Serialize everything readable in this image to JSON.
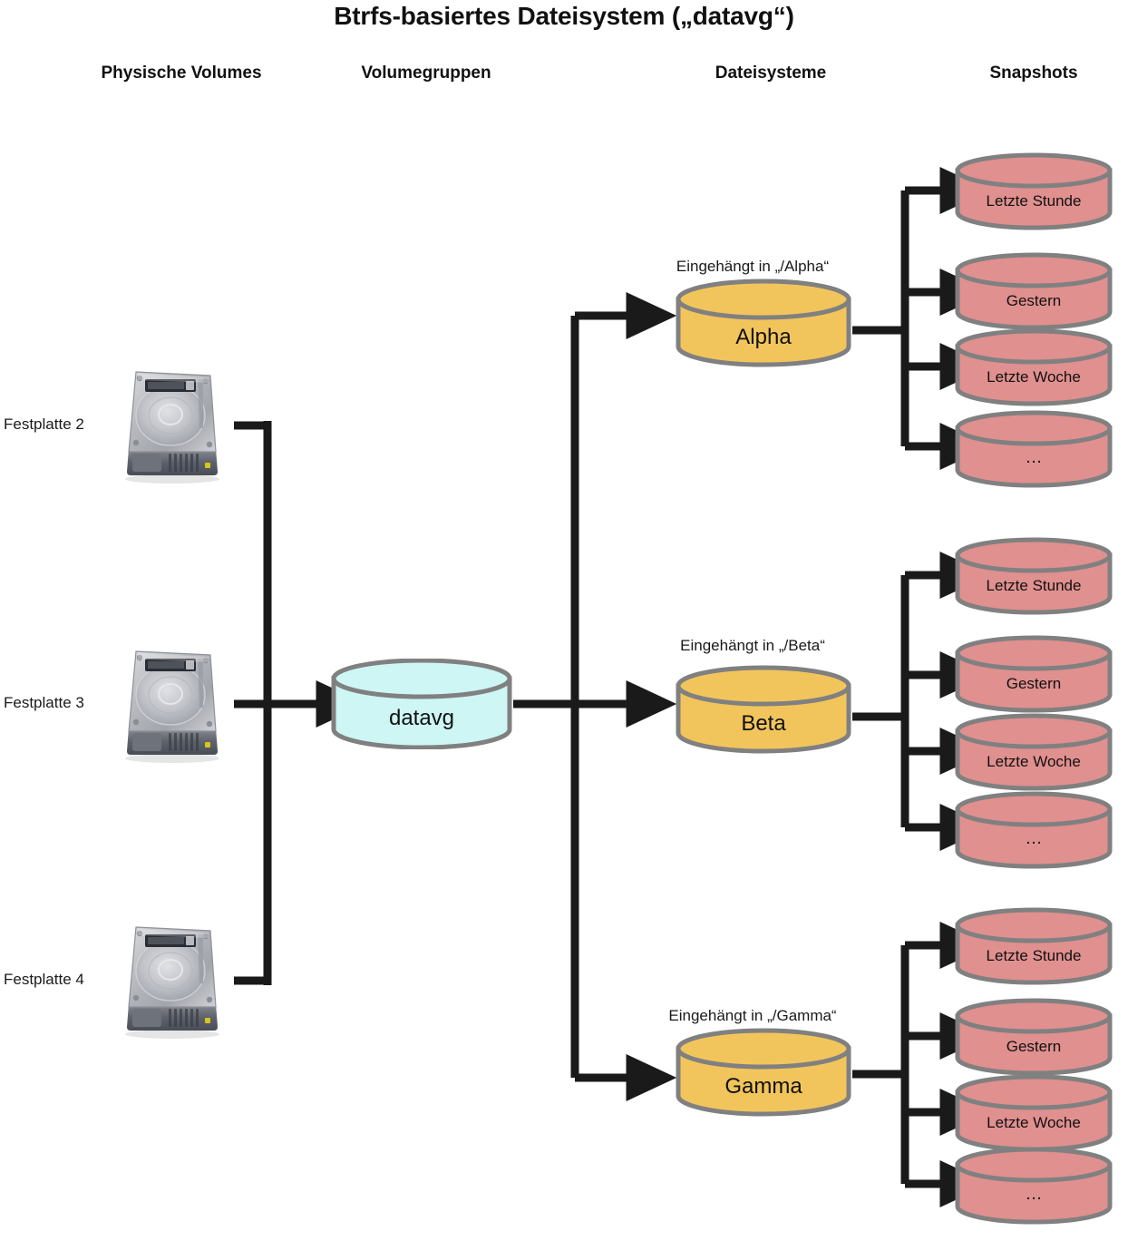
{
  "diagram": {
    "title": "Btrfs-basiertes Dateisystem („datavg“)",
    "columns": [
      {
        "id": "physical-volumes",
        "label": "Physische Volumes"
      },
      {
        "id": "volume-groups",
        "label": "Volumegruppen"
      },
      {
        "id": "filesystems",
        "label": "Dateisysteme"
      },
      {
        "id": "snapshots",
        "label": "Snapshots"
      }
    ],
    "colors": {
      "volume_group_fill": "#cdf6f5",
      "filesystem_fill": "#f2c55c",
      "snapshot_fill": "#e0908f",
      "cylinder_stroke": "#808080",
      "connector": "#1a1a1a",
      "background": "#ffffff",
      "text": "#1a1a1a"
    },
    "physical_volumes": [
      {
        "label": "Festplatte 2",
        "icon": "hard-disk-icon"
      },
      {
        "label": "Festplatte 3",
        "icon": "hard-disk-icon"
      },
      {
        "label": "Festplatte 4",
        "icon": "hard-disk-icon"
      }
    ],
    "volume_group": {
      "label": "datavg"
    },
    "filesystems": [
      {
        "name": "Alpha",
        "mount_caption": "Eingehängt in „/Alpha“",
        "snapshots": [
          {
            "label": "Letzte Stunde"
          },
          {
            "label": "Gestern"
          },
          {
            "label": "Letzte Woche"
          },
          {
            "label": "…"
          }
        ]
      },
      {
        "name": "Beta",
        "mount_caption": "Eingehängt in „/Beta“",
        "snapshots": [
          {
            "label": "Letzte Stunde"
          },
          {
            "label": "Gestern"
          },
          {
            "label": "Letzte Woche"
          },
          {
            "label": "…"
          }
        ]
      },
      {
        "name": "Gamma",
        "mount_caption": "Eingehängt in „/Gamma“",
        "snapshots": [
          {
            "label": "Letzte Stunde"
          },
          {
            "label": "Gestern"
          },
          {
            "label": "Letzte Woche"
          },
          {
            "label": "…"
          }
        ]
      }
    ]
  }
}
